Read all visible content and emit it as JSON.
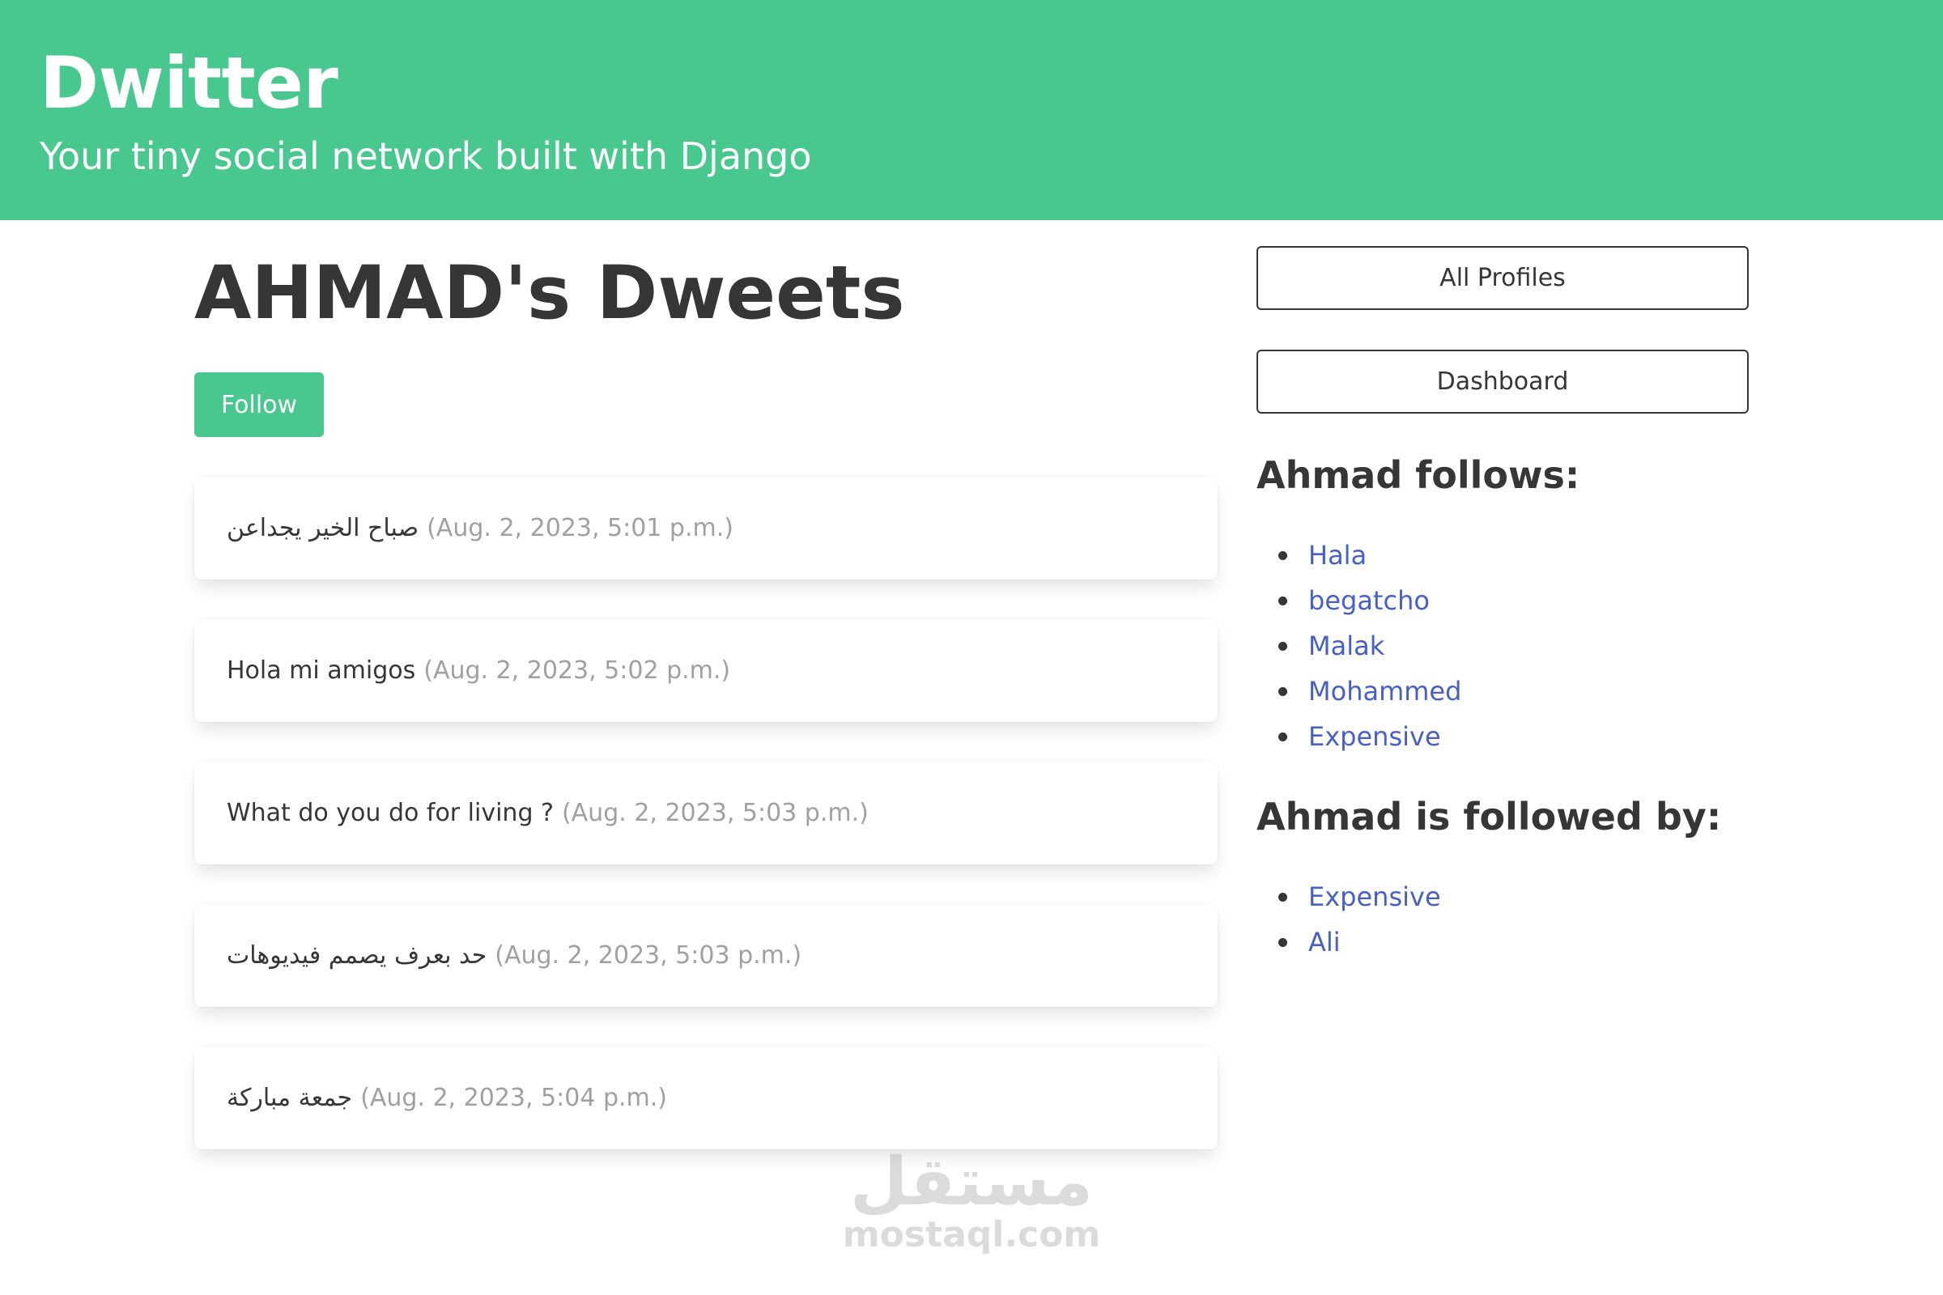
{
  "hero": {
    "title": "Dwitter",
    "subtitle": "Your tiny social network built with Django"
  },
  "profile": {
    "title": "AHMAD's Dweets",
    "follow_label": "Follow"
  },
  "dweets": [
    {
      "body": "صباح الخير يجداعن",
      "timestamp": "(Aug. 2, 2023, 5:01 p.m.)"
    },
    {
      "body": "Hola mi amigos",
      "timestamp": "(Aug. 2, 2023, 5:02 p.m.)"
    },
    {
      "body": "What do you do for living ?",
      "timestamp": "(Aug. 2, 2023, 5:03 p.m.)"
    },
    {
      "body": "حد بعرف يصمم فيديوهات",
      "timestamp": "(Aug. 2, 2023, 5:03 p.m.)"
    },
    {
      "body": "جمعة مباركة",
      "timestamp": "(Aug. 2, 2023, 5:04 p.m.)"
    }
  ],
  "sidebar": {
    "all_profiles_label": "All Profiles",
    "dashboard_label": "Dashboard",
    "follows_heading": "Ahmad follows:",
    "follows": [
      "Hala",
      "begatcho",
      "Malak",
      "Mohammed",
      "Expensive"
    ],
    "followed_by_heading": "Ahmad is followed by:",
    "followed_by": [
      "Expensive",
      "Ali"
    ]
  },
  "watermark": {
    "arabic": "مستقل",
    "latin": "mostaql.com"
  },
  "colors": {
    "primary": "#48c78e",
    "link": "#485fc7",
    "text": "#363636",
    "muted": "#a0a0a0"
  }
}
